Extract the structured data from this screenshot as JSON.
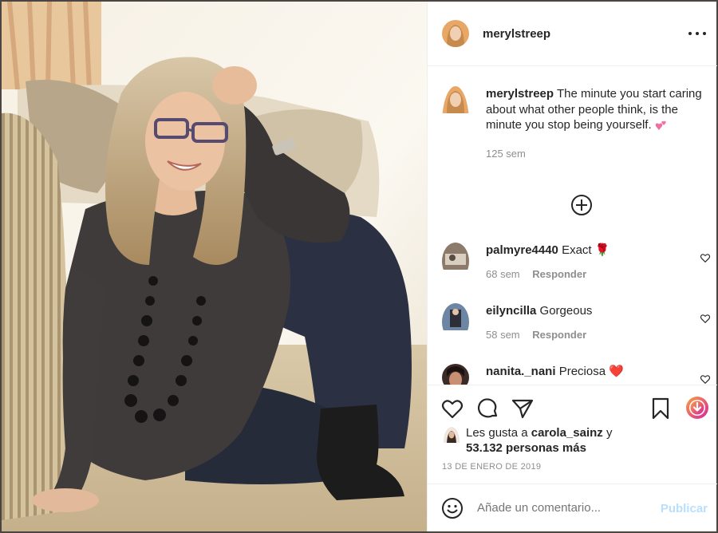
{
  "post": {
    "author": "merylstreep",
    "more_icon": "more-options-icon",
    "caption": {
      "username": "merylstreep",
      "text": "The minute you start caring about what other people think, is the minute you stop being yourself.",
      "emoji": "💕",
      "time": "125 sem"
    },
    "load_more_icon": "plus-circle-icon"
  },
  "comments": [
    {
      "username": "palmyre4440",
      "text": "Exact",
      "emoji": "🌹",
      "time": "68 sem",
      "reply": "Responder"
    },
    {
      "username": "eilyncilla",
      "text": "Gorgeous",
      "emoji": "",
      "time": "58 sem",
      "reply": "Responder"
    },
    {
      "username": "nanita._nani",
      "text": "Preciosa",
      "emoji": "❤️",
      "time": "",
      "reply": ""
    }
  ],
  "actions": {
    "like_icon": "heart-icon",
    "comment_icon": "comment-icon",
    "share_icon": "send-icon",
    "save_icon": "bookmark-icon",
    "download_icon": "download-icon"
  },
  "likes": {
    "prefix": "Les gusta a",
    "user": "carola_sainz",
    "conj": "y",
    "others": "53.132 personas más"
  },
  "date": "13 DE ENERO DE 2019",
  "add_comment": {
    "placeholder": "Añade un comentario...",
    "publish": "Publicar"
  },
  "colors": {
    "link_disabled": "#b9dffc",
    "muted": "#8e8e8e",
    "text": "#262626",
    "heart_red": "#e0245e"
  }
}
